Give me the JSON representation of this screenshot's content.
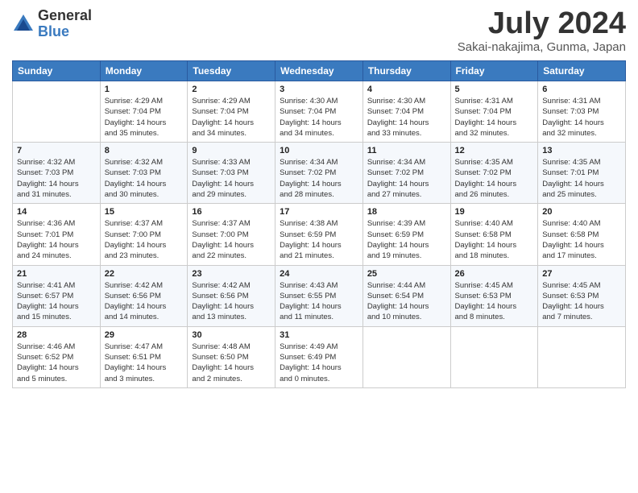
{
  "header": {
    "logo_general": "General",
    "logo_blue": "Blue",
    "month_title": "July 2024",
    "location": "Sakai-nakajima, Gunma, Japan"
  },
  "days_of_week": [
    "Sunday",
    "Monday",
    "Tuesday",
    "Wednesday",
    "Thursday",
    "Friday",
    "Saturday"
  ],
  "weeks": [
    [
      {
        "day": "",
        "info": ""
      },
      {
        "day": "1",
        "info": "Sunrise: 4:29 AM\nSunset: 7:04 PM\nDaylight: 14 hours\nand 35 minutes."
      },
      {
        "day": "2",
        "info": "Sunrise: 4:29 AM\nSunset: 7:04 PM\nDaylight: 14 hours\nand 34 minutes."
      },
      {
        "day": "3",
        "info": "Sunrise: 4:30 AM\nSunset: 7:04 PM\nDaylight: 14 hours\nand 34 minutes."
      },
      {
        "day": "4",
        "info": "Sunrise: 4:30 AM\nSunset: 7:04 PM\nDaylight: 14 hours\nand 33 minutes."
      },
      {
        "day": "5",
        "info": "Sunrise: 4:31 AM\nSunset: 7:04 PM\nDaylight: 14 hours\nand 32 minutes."
      },
      {
        "day": "6",
        "info": "Sunrise: 4:31 AM\nSunset: 7:03 PM\nDaylight: 14 hours\nand 32 minutes."
      }
    ],
    [
      {
        "day": "7",
        "info": "Sunrise: 4:32 AM\nSunset: 7:03 PM\nDaylight: 14 hours\nand 31 minutes."
      },
      {
        "day": "8",
        "info": "Sunrise: 4:32 AM\nSunset: 7:03 PM\nDaylight: 14 hours\nand 30 minutes."
      },
      {
        "day": "9",
        "info": "Sunrise: 4:33 AM\nSunset: 7:03 PM\nDaylight: 14 hours\nand 29 minutes."
      },
      {
        "day": "10",
        "info": "Sunrise: 4:34 AM\nSunset: 7:02 PM\nDaylight: 14 hours\nand 28 minutes."
      },
      {
        "day": "11",
        "info": "Sunrise: 4:34 AM\nSunset: 7:02 PM\nDaylight: 14 hours\nand 27 minutes."
      },
      {
        "day": "12",
        "info": "Sunrise: 4:35 AM\nSunset: 7:02 PM\nDaylight: 14 hours\nand 26 minutes."
      },
      {
        "day": "13",
        "info": "Sunrise: 4:35 AM\nSunset: 7:01 PM\nDaylight: 14 hours\nand 25 minutes."
      }
    ],
    [
      {
        "day": "14",
        "info": "Sunrise: 4:36 AM\nSunset: 7:01 PM\nDaylight: 14 hours\nand 24 minutes."
      },
      {
        "day": "15",
        "info": "Sunrise: 4:37 AM\nSunset: 7:00 PM\nDaylight: 14 hours\nand 23 minutes."
      },
      {
        "day": "16",
        "info": "Sunrise: 4:37 AM\nSunset: 7:00 PM\nDaylight: 14 hours\nand 22 minutes."
      },
      {
        "day": "17",
        "info": "Sunrise: 4:38 AM\nSunset: 6:59 PM\nDaylight: 14 hours\nand 21 minutes."
      },
      {
        "day": "18",
        "info": "Sunrise: 4:39 AM\nSunset: 6:59 PM\nDaylight: 14 hours\nand 19 minutes."
      },
      {
        "day": "19",
        "info": "Sunrise: 4:40 AM\nSunset: 6:58 PM\nDaylight: 14 hours\nand 18 minutes."
      },
      {
        "day": "20",
        "info": "Sunrise: 4:40 AM\nSunset: 6:58 PM\nDaylight: 14 hours\nand 17 minutes."
      }
    ],
    [
      {
        "day": "21",
        "info": "Sunrise: 4:41 AM\nSunset: 6:57 PM\nDaylight: 14 hours\nand 15 minutes."
      },
      {
        "day": "22",
        "info": "Sunrise: 4:42 AM\nSunset: 6:56 PM\nDaylight: 14 hours\nand 14 minutes."
      },
      {
        "day": "23",
        "info": "Sunrise: 4:42 AM\nSunset: 6:56 PM\nDaylight: 14 hours\nand 13 minutes."
      },
      {
        "day": "24",
        "info": "Sunrise: 4:43 AM\nSunset: 6:55 PM\nDaylight: 14 hours\nand 11 minutes."
      },
      {
        "day": "25",
        "info": "Sunrise: 4:44 AM\nSunset: 6:54 PM\nDaylight: 14 hours\nand 10 minutes."
      },
      {
        "day": "26",
        "info": "Sunrise: 4:45 AM\nSunset: 6:53 PM\nDaylight: 14 hours\nand 8 minutes."
      },
      {
        "day": "27",
        "info": "Sunrise: 4:45 AM\nSunset: 6:53 PM\nDaylight: 14 hours\nand 7 minutes."
      }
    ],
    [
      {
        "day": "28",
        "info": "Sunrise: 4:46 AM\nSunset: 6:52 PM\nDaylight: 14 hours\nand 5 minutes."
      },
      {
        "day": "29",
        "info": "Sunrise: 4:47 AM\nSunset: 6:51 PM\nDaylight: 14 hours\nand 3 minutes."
      },
      {
        "day": "30",
        "info": "Sunrise: 4:48 AM\nSunset: 6:50 PM\nDaylight: 14 hours\nand 2 minutes."
      },
      {
        "day": "31",
        "info": "Sunrise: 4:49 AM\nSunset: 6:49 PM\nDaylight: 14 hours\nand 0 minutes."
      },
      {
        "day": "",
        "info": ""
      },
      {
        "day": "",
        "info": ""
      },
      {
        "day": "",
        "info": ""
      }
    ]
  ]
}
